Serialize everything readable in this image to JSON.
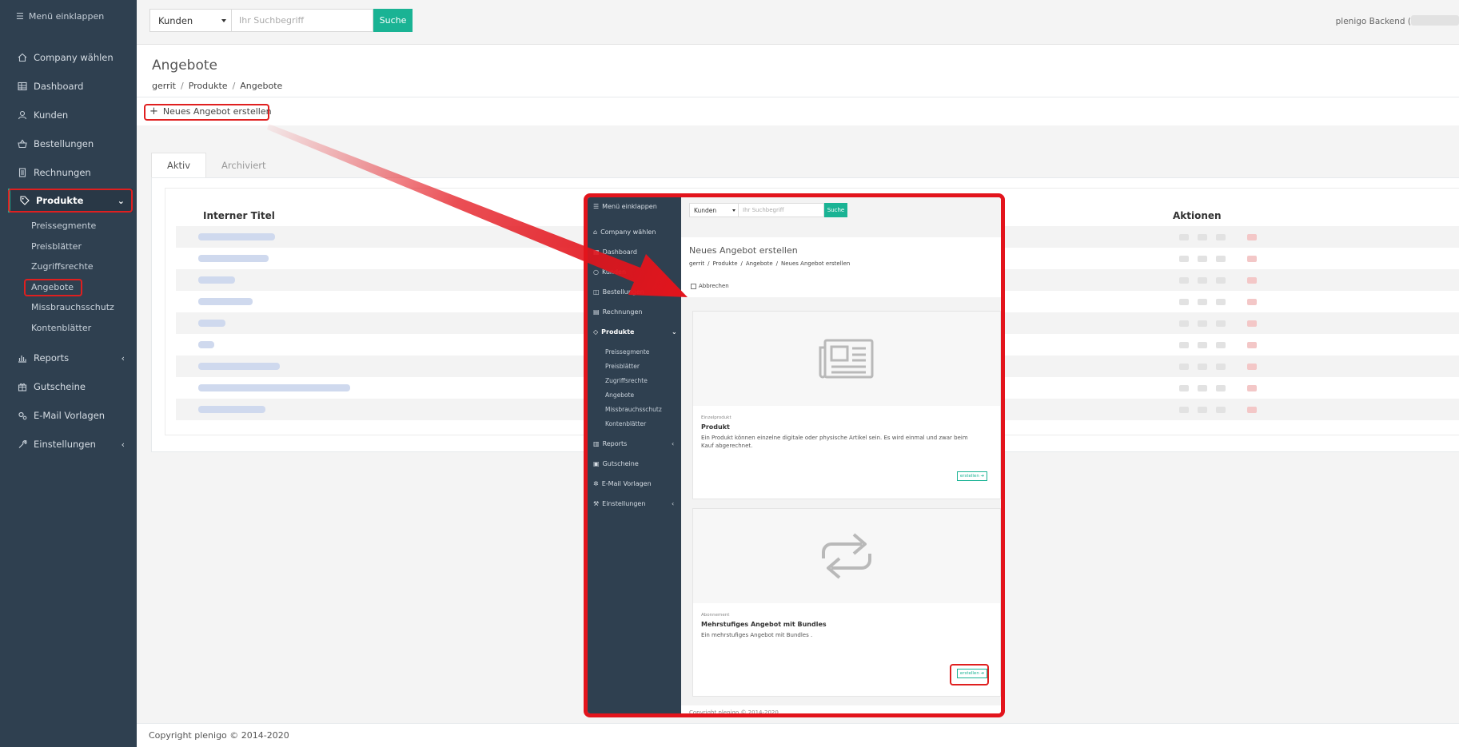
{
  "sidebar": {
    "collapse_label": "Menü einklappen",
    "items": [
      {
        "label": "Company wählen"
      },
      {
        "label": "Dashboard"
      },
      {
        "label": "Kunden"
      },
      {
        "label": "Bestellungen"
      },
      {
        "label": "Rechnungen"
      },
      {
        "label": "Produkte"
      },
      {
        "label": "Reports"
      },
      {
        "label": "Gutscheine"
      },
      {
        "label": "E-Mail Vorlagen"
      },
      {
        "label": "Einstellungen"
      }
    ],
    "subitems": [
      {
        "label": "Preissegmente"
      },
      {
        "label": "Preisblätter"
      },
      {
        "label": "Zugriffsrechte"
      },
      {
        "label": "Angebote"
      },
      {
        "label": "Missbrauchsschutz"
      },
      {
        "label": "Kontenblätter"
      }
    ]
  },
  "search": {
    "scope_value": "Kunden",
    "placeholder": "Ihr Suchbegriff",
    "button_label": "Suche"
  },
  "header": {
    "user_label": "plenigo Backend (",
    "title": "Angebote",
    "breadcrumbs": [
      "gerrit",
      "Produkte",
      "Angebote"
    ],
    "breadcrumb_sep": "/"
  },
  "toolbar": {
    "new_offer_label": "Neues Angebot erstellen"
  },
  "tabs": [
    {
      "label": "Aktiv"
    },
    {
      "label": "Archiviert"
    }
  ],
  "table": {
    "col_title": "Interner Titel",
    "col_actions": "Aktionen"
  },
  "footer": {
    "copyright": "Copyright plenigo © 2014-2020"
  },
  "inset": {
    "collapse_label": "Menü einklappen",
    "search_scope": "Kunden",
    "search_placeholder": "Ihr Suchbegriff",
    "search_button": "Suche",
    "title": "Neues Angebot erstellen",
    "breadcrumbs": [
      "gerrit",
      "Produkte",
      "Angebote",
      "Neues Angebot erstellen"
    ],
    "breadcrumb_sep": "/",
    "cancel_label": "Abbrechen",
    "sidebar_items": [
      {
        "label": "Company wählen"
      },
      {
        "label": "Dashboard"
      },
      {
        "label": "Kunden"
      },
      {
        "label": "Bestellungen"
      },
      {
        "label": "Rechnungen"
      },
      {
        "label": "Produkte"
      },
      {
        "label": "Reports"
      },
      {
        "label": "Gutscheine"
      },
      {
        "label": "E-Mail Vorlagen"
      },
      {
        "label": "Einstellungen"
      }
    ],
    "sidebar_subitems": [
      {
        "label": "Preissegmente"
      },
      {
        "label": "Preisblätter"
      },
      {
        "label": "Zugriffsrechte"
      },
      {
        "label": "Angebote"
      },
      {
        "label": "Missbrauchsschutz"
      },
      {
        "label": "Kontenblätter"
      }
    ],
    "cards": [
      {
        "category": "Einzelprodukt",
        "title": "Produkt",
        "description": "Ein Produkt können einzelne digitale oder physische Artikel sein. Es wird einmal und zwar beim Kauf abgerechnet.",
        "button": "erstellen ➔"
      },
      {
        "category": "Abonnement",
        "title": "Mehrstufiges Angebot mit Bundles",
        "description": "Ein mehrstufiges Angebot mit Bundles .",
        "button": "erstellen ➔"
      }
    ],
    "footer": "Copyright plenigo © 2014-2020"
  },
  "colors": {
    "sidebar_bg": "#2f4050",
    "accent": "#1ab394",
    "highlight_red": "#e3141c"
  }
}
